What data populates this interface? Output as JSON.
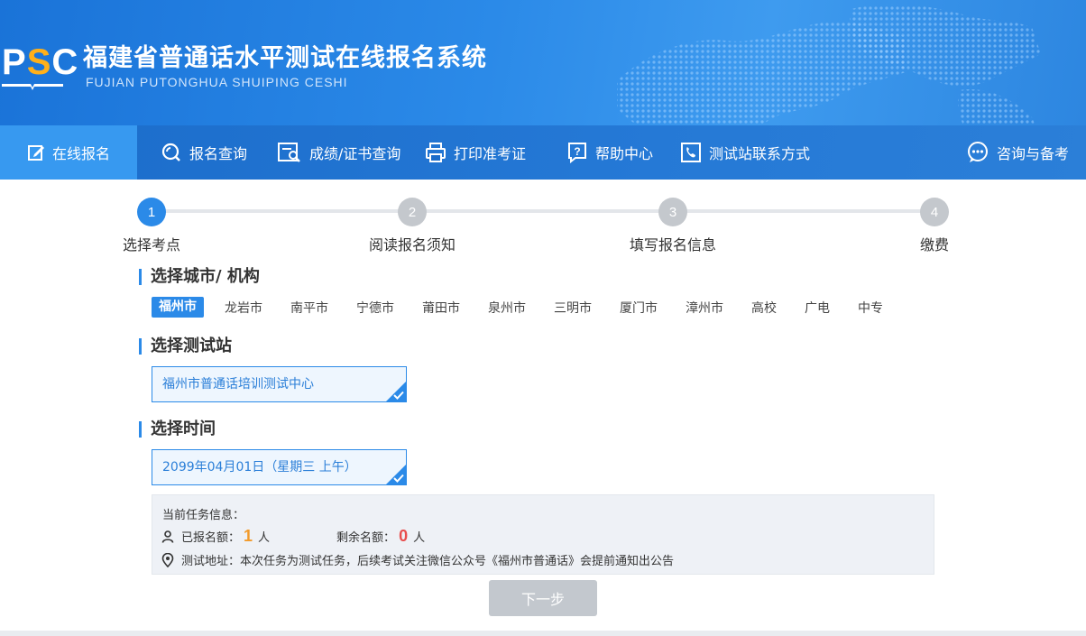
{
  "header": {
    "logo_p": "P",
    "logo_s": "S",
    "logo_c": "C",
    "title": "福建省普通话水平测试在线报名系统",
    "subtitle": "FUJIAN PUTONGHUA SHUIPING CESHI"
  },
  "nav": {
    "items": [
      {
        "label": "在线报名",
        "icon": "edit-icon"
      },
      {
        "label": "报名查询",
        "icon": "search-icon"
      },
      {
        "label": "成绩/证书查询",
        "icon": "certificate-search-icon"
      },
      {
        "label": "打印准考证",
        "icon": "printer-icon"
      },
      {
        "label": "帮助中心",
        "icon": "help-icon"
      },
      {
        "label": "测试站联系方式",
        "icon": "phone-contact-icon"
      },
      {
        "label": "咨询与备考",
        "icon": "chat-icon"
      }
    ]
  },
  "steps": [
    {
      "num": "1",
      "label": "选择考点"
    },
    {
      "num": "2",
      "label": "阅读报名须知"
    },
    {
      "num": "3",
      "label": "填写报名信息"
    },
    {
      "num": "4",
      "label": "缴费"
    }
  ],
  "city_section": {
    "title": "选择城市/ 机构",
    "cities": [
      "福州市",
      "龙岩市",
      "南平市",
      "宁德市",
      "莆田市",
      "泉州市",
      "三明市",
      "厦门市",
      "漳州市",
      "高校",
      "广电",
      "中专"
    ]
  },
  "station_section": {
    "title": "选择测试站",
    "selected": "福州市普通话培训测试中心"
  },
  "time_section": {
    "title": "选择时间",
    "selected": "2099年04月01日（星期三 上午）"
  },
  "task_info": {
    "title": "当前任务信息：",
    "registered_label": "已报名额：",
    "registered_count": "1",
    "registered_unit": "人",
    "remaining_label": "剩余名额：",
    "remaining_count": "0",
    "remaining_unit": "人",
    "address_label": "测试地址：",
    "address_text": "本次任务为测试任务，后续考试关注微信公众号《福州市普通话》会提前通知出公告"
  },
  "next_button": "下一步",
  "colors": {
    "primary": "#2b8ae8",
    "nav": "#1b6cca",
    "orange": "#f29b2b",
    "red": "#e84d4d"
  }
}
